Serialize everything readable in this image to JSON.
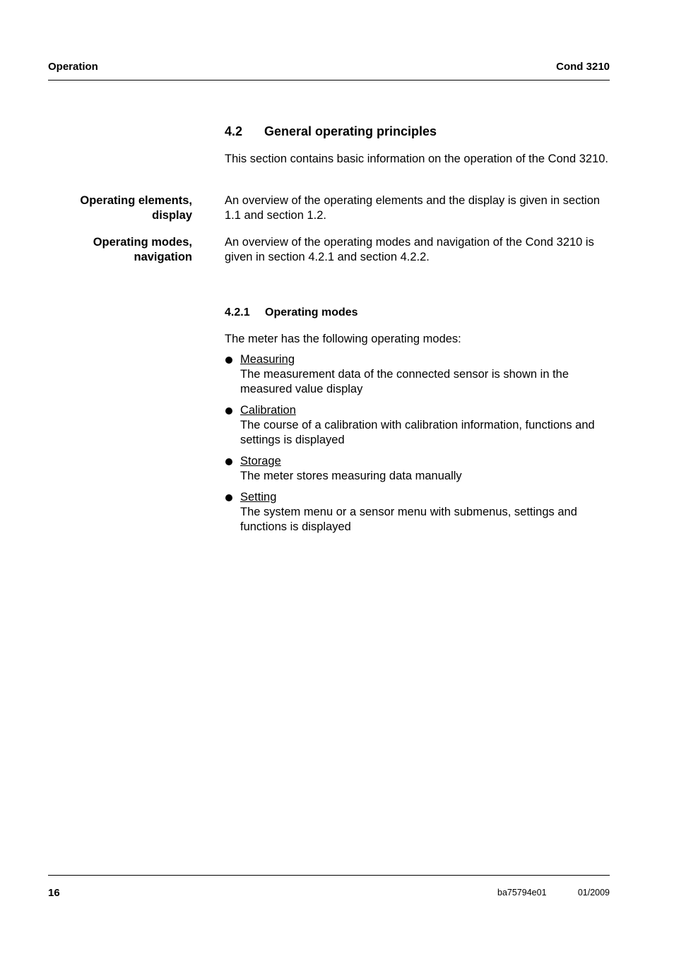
{
  "header": {
    "left": "Operation",
    "right": "Cond 3210"
  },
  "section": {
    "number": "4.2",
    "title": "General operating principles",
    "intro": "This section contains basic information on the operation of the Cond 3210."
  },
  "margin_notes": [
    {
      "label": "Operating elements, display",
      "text": "An overview of the operating elements and the display is given in section 1.1 and section 1.2."
    },
    {
      "label": "Operating modes, navigation",
      "text": "An overview of the operating modes and navigation of the Cond 3210 is given in section 4.2.1 and section 4.2.2."
    }
  ],
  "subsection": {
    "number": "4.2.1",
    "title": "Operating modes",
    "intro": "The meter has the following operating modes:",
    "modes": [
      {
        "title": "Measuring",
        "description": "The measurement data of the connected sensor is shown in the measured value display"
      },
      {
        "title": "Calibration",
        "description": "The course of a calibration with calibration information, functions and settings is displayed"
      },
      {
        "title": "Storage",
        "description": "The meter stores measuring data manually"
      },
      {
        "title": "Setting",
        "description": "The system menu or a sensor menu with submenus, settings and functions is displayed"
      }
    ]
  },
  "footer": {
    "page_number": "16",
    "doc_id": "ba75794e01",
    "date": "01/2009"
  }
}
